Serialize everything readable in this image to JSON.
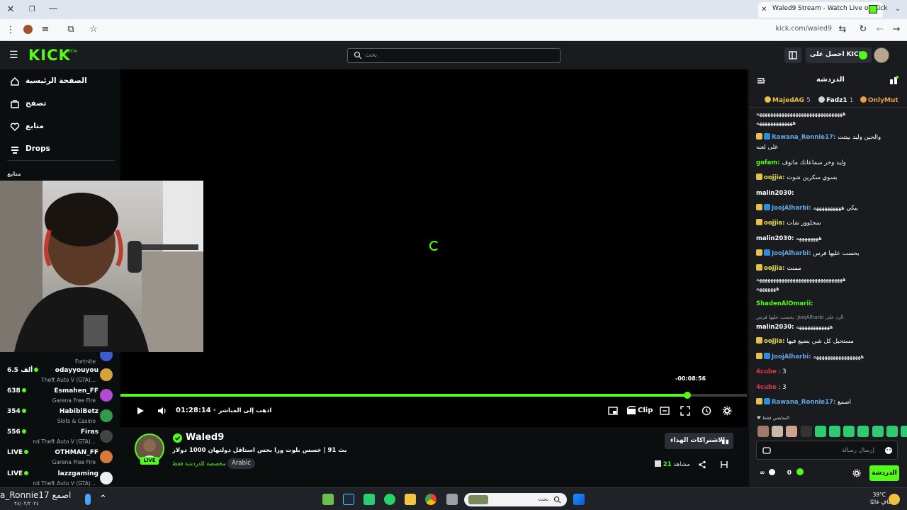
{
  "browser": {
    "tab_title": "Waled9 Stream - Watch Live on Kick",
    "url": "kick.com/waled9"
  },
  "header": {
    "logo": "KICK",
    "logo_badge": "BETA",
    "search_placeholder": "بحث",
    "get_kicks_label": "احصل على KICKs"
  },
  "sidebar": {
    "nav": [
      {
        "label": "الصفحة الرئيسية",
        "icon": "home-icon"
      },
      {
        "label": "تصفح",
        "icon": "browse-icon"
      },
      {
        "label": "متابع",
        "icon": "heart-icon"
      },
      {
        "label": "Drops",
        "icon": "drops-icon"
      }
    ],
    "section_title": "متابع",
    "channels": [
      {
        "name": "",
        "game": "Fortnite",
        "viewers": "",
        "color": "#3b5bd6"
      },
      {
        "name": "odayyouyou",
        "game": "Theft Auto V (GTA)...",
        "viewers": "6.5 ألف",
        "color": "#d6a33b"
      },
      {
        "name": "Esmahen_FF",
        "game": "Garena Free Fire",
        "viewers": "638",
        "color": "#b04bd6"
      },
      {
        "name": "HabibiBetz",
        "game": "Slots & Casino",
        "viewers": "354",
        "color": "#2e9c4a"
      },
      {
        "name": "Firas",
        "game": "nd Theft Auto V (GTA)...",
        "viewers": "556",
        "color": "#444"
      },
      {
        "name": "OTHMAN_FF",
        "game": "Garena Free Fire",
        "viewers": "LIVE",
        "color": "#d67a3b"
      },
      {
        "name": "lazzgaming",
        "game": "nd Theft Auto V (GTA)...",
        "viewers": "LIVE",
        "color": "#eeeeee"
      }
    ]
  },
  "player": {
    "progress_fraction": 0.907,
    "hover_time": "-00:08:56",
    "time": "01:28:14",
    "go_live": "اذهب إلى المباشر",
    "clip_label": "Clip"
  },
  "stream": {
    "streamer": "Waled9",
    "live_badge": "LIVE",
    "title": "بث 91 | خسس بلوت ورا بحس استاقل دولتهان 1000 دولار",
    "category": "مخصصة للدردشة فقط",
    "language": "Arabic",
    "subs_button": "الاشتراكات الهداء",
    "viewers_count": "21",
    "viewers_label": "مشاهد"
  },
  "chat": {
    "title": "الدردشة",
    "gifters": [
      {
        "name": "OnlyMut",
        "count": "",
        "color": "#e7a14a"
      },
      {
        "name": "Fadz1",
        "count": "1",
        "color": "#cfd3d8"
      },
      {
        "name": "MajedAG",
        "count": "5",
        "color": "#e7c14a"
      }
    ],
    "messages": [
      {
        "user": "",
        "text": "هههههههههههههههههههههههههههههههه",
        "color": "#ffffff"
      },
      {
        "user": "",
        "text": "هههههههههههههه",
        "color": "#ffffff"
      },
      {
        "user": "Rawana_Ronnie17:",
        "text": "والحين وليد بيتنت",
        "color": "#62a8e8"
      },
      {
        "user": "",
        "text": "على لعبه",
        "color": "#ffffff"
      },
      {
        "user": "gofam:",
        "text": "وليد وخر سماعاتك ماتوف",
        "color": "#53fc18"
      },
      {
        "user": "oojjia:",
        "text": "بسوي سكرين شوت",
        "color": "#e7e04a"
      },
      {
        "user": "malin2030:",
        "text": "",
        "color": "#ffffff"
      },
      {
        "user": "JoojAlharbi:",
        "text": "بيكي ههههههههههه",
        "color": "#62a8e8"
      },
      {
        "user": "oojjia:",
        "text": "سجلوور شات",
        "color": "#e7e04a"
      },
      {
        "user": "malin2030:",
        "text": "ههههههههه",
        "color": "#ffffff"
      },
      {
        "user": "JoojAlharbi:",
        "text": "يحسب عليها فرس",
        "color": "#62a8e8"
      },
      {
        "user": "oojjia:",
        "text": "ممنت",
        "color": "#e7e04a"
      },
      {
        "user": "",
        "text": "هههههههههههههههههههههههههههههههه",
        "color": "#ffffff"
      },
      {
        "user": "",
        "text": "هههههههه",
        "color": "#ffffff"
      },
      {
        "user": "ShadenAlOmarii:",
        "text": "",
        "color": "#53fc18"
      },
      {
        "user": "",
        "text": "يحسب عليها فرس :JoojAlharbi الرد على",
        "color": "#9aa0a6"
      },
      {
        "user": "malin2030:",
        "text": "ههههههههههههه",
        "color": "#ffffff"
      },
      {
        "user": "oojjia:",
        "text": "مستحيل كل شي يضيع فيها",
        "color": "#e7e04a"
      },
      {
        "user": "JoojAlharbi:",
        "text": "هههههههههههههههههه",
        "color": "#62a8e8"
      },
      {
        "user": "4cube",
        "text": ": 3",
        "color": "#e0364d"
      },
      {
        "user": "4cube",
        "text": ": 3",
        "color": "#e0364d"
      },
      {
        "user": "Rawana_Ronnie17:",
        "text": "اصمع",
        "color": "#62a8e8"
      }
    ],
    "emotes_label": "المتابعين فقط",
    "input_placeholder": "إرسال رسالة",
    "send_label": "الدردشة",
    "kicks_balance": "0"
  },
  "taskbar": {
    "search_placeholder": "بحث",
    "user_text": "a_Ronnie17 اصمع",
    "date": "٢٨/٠٢/٢٠٢٤",
    "temp": "39°C",
    "weather": "صافٍ غالبًا"
  }
}
